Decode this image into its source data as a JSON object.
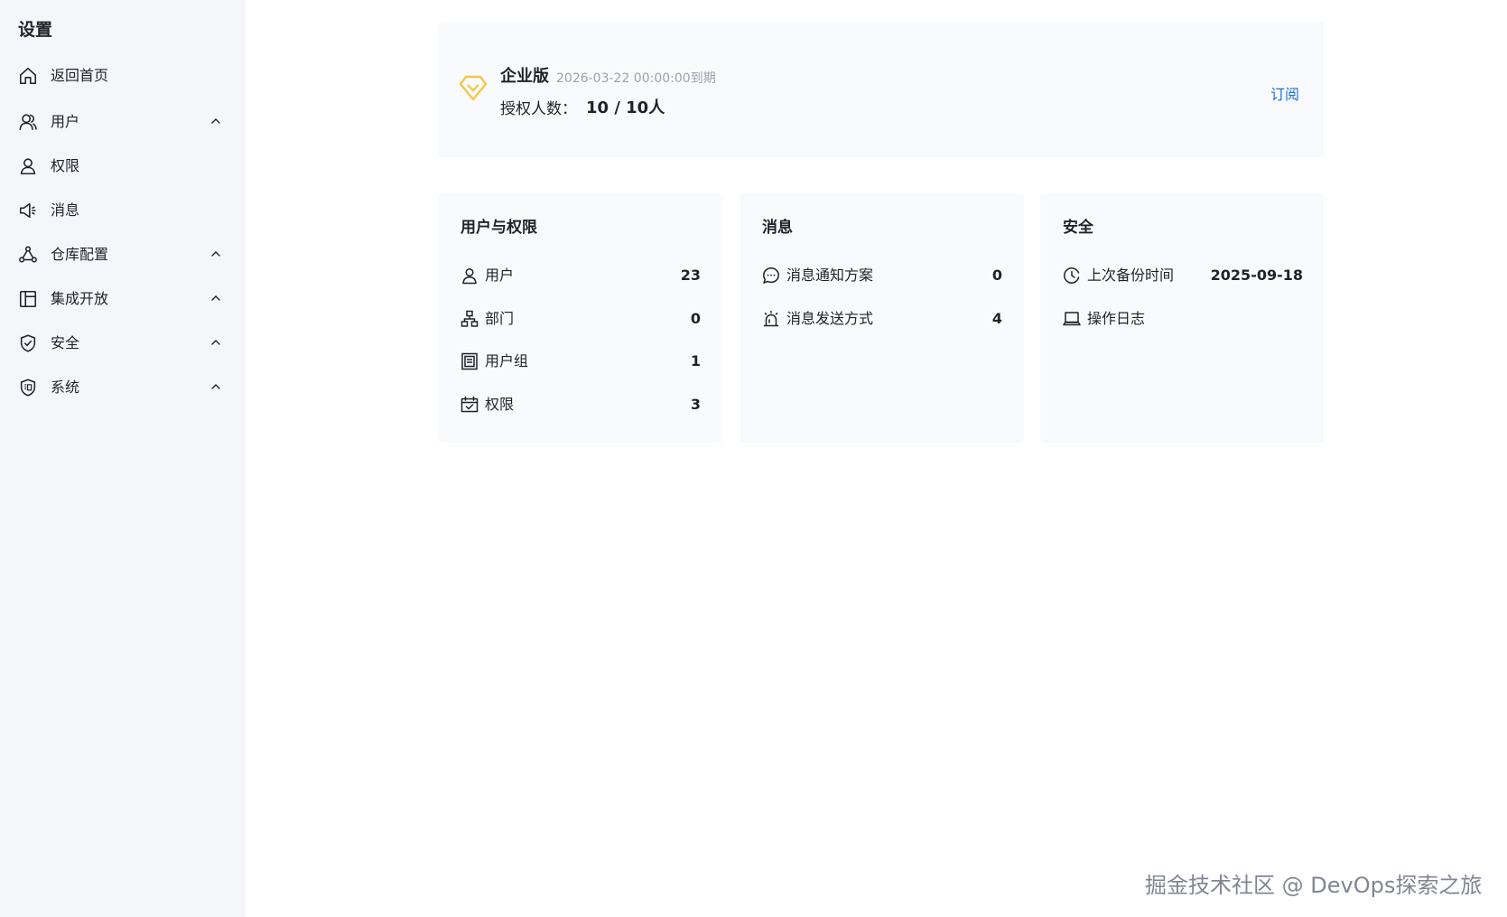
{
  "sidebar": {
    "title": "设置",
    "items": [
      {
        "label": "返回首页",
        "icon": "home-icon",
        "expandable": false
      },
      {
        "label": "用户",
        "icon": "users-icon",
        "expandable": true
      },
      {
        "label": "权限",
        "icon": "user-icon",
        "expandable": false
      },
      {
        "label": "消息",
        "icon": "megaphone-icon",
        "expandable": false
      },
      {
        "label": "仓库配置",
        "icon": "nodes-icon",
        "expandable": true
      },
      {
        "label": "集成开放",
        "icon": "layout-icon",
        "expandable": true
      },
      {
        "label": "安全",
        "icon": "shield-check-icon",
        "expandable": true
      },
      {
        "label": "系统",
        "icon": "shield-cert-icon",
        "expandable": true
      }
    ]
  },
  "license": {
    "edition": "企业版",
    "expire_text": "2026-03-22 00:00:00到期",
    "users_label": "授权人数：",
    "users_value": "10 / 10人",
    "subscribe_label": "订阅",
    "icon": "diamond-icon",
    "icon_color": "#f2c94c"
  },
  "cards": {
    "users": {
      "title": "用户与权限",
      "rows": [
        {
          "label": "用户",
          "value": "23",
          "icon": "user-icon"
        },
        {
          "label": "部门",
          "value": "0",
          "icon": "org-icon"
        },
        {
          "label": "用户组",
          "value": "1",
          "icon": "group-icon"
        },
        {
          "label": "权限",
          "value": "3",
          "icon": "calendar-check-icon"
        }
      ]
    },
    "messages": {
      "title": "消息",
      "rows": [
        {
          "label": "消息通知方案",
          "value": "0",
          "icon": "chat-icon"
        },
        {
          "label": "消息发送方式",
          "value": "4",
          "icon": "alarm-icon"
        }
      ]
    },
    "security": {
      "title": "安全",
      "rows": [
        {
          "label": "上次备份时间",
          "value": "2025-09-18",
          "icon": "clock-icon"
        },
        {
          "label": "操作日志",
          "value": "",
          "icon": "laptop-icon"
        }
      ]
    }
  },
  "watermark": "掘金技术社区 @ DevOps探索之旅",
  "colors": {
    "sidebar_bg": "#f4f6fa",
    "card_bg": "#f9fafc",
    "link": "#1e6fd9",
    "muted": "#9ca3af"
  }
}
